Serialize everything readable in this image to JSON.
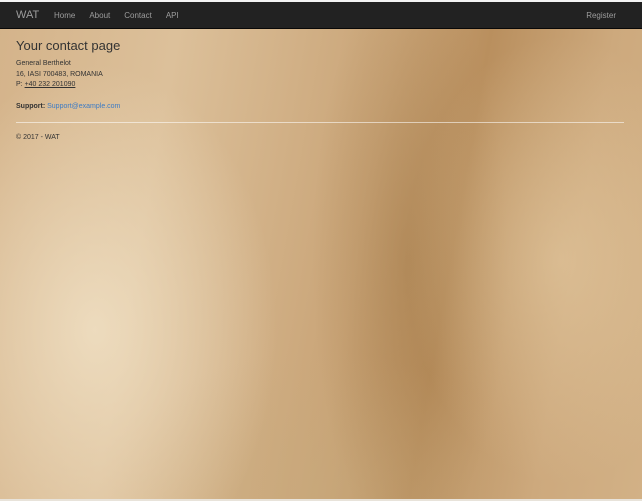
{
  "navbar": {
    "brand": "WAT",
    "links": [
      {
        "label": "Home"
      },
      {
        "label": "About"
      },
      {
        "label": "Contact"
      },
      {
        "label": "API"
      }
    ],
    "register_label": "Register"
  },
  "main": {
    "title": "Your contact page",
    "address": {
      "line1": "General Berthelot",
      "line2": "16, IASI 700483, ROMANIA",
      "phone_prefix": "P:",
      "phone": "+40 232 201090"
    },
    "support": {
      "label": "Support:",
      "email": "Support@example.com"
    }
  },
  "footer": {
    "text": "© 2017 - WAT"
  },
  "colors": {
    "navbar_bg": "#222222",
    "nav_text": "#9d9d9d",
    "link": "#3d7bc4"
  }
}
